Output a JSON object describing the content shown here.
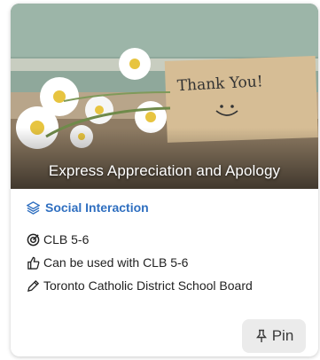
{
  "card": {
    "title": "Express Appreciation and Apology",
    "card_note_text": "Thank You!",
    "category": "Social Interaction",
    "level": "CLB 5-6",
    "usage": "Can be used with CLB 5-6",
    "organization": "Toronto Catholic District School Board",
    "pin_label": "Pin"
  },
  "colors": {
    "category": "#2f6fc0",
    "pin_bg": "#ebebeb"
  },
  "icons": [
    "layers-icon",
    "target-icon",
    "thumbs-up-icon",
    "pencil-icon",
    "pin-icon"
  ]
}
